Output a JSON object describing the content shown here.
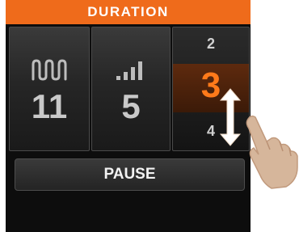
{
  "header": {
    "title": "DURATION"
  },
  "tiles": {
    "wave": {
      "icon": "square-wave-icon",
      "value": "11"
    },
    "level": {
      "icon": "signal-bars-icon",
      "value": "5"
    }
  },
  "picker": {
    "prev": "2",
    "selected": "3",
    "next": "4"
  },
  "pause_label": "PAUSE",
  "overlay": {
    "arrow": "vertical-double-arrow-icon",
    "hand": "pointing-hand-icon"
  },
  "colors": {
    "accent": "#ef6b1b",
    "selected_text": "#ff7a1a"
  }
}
